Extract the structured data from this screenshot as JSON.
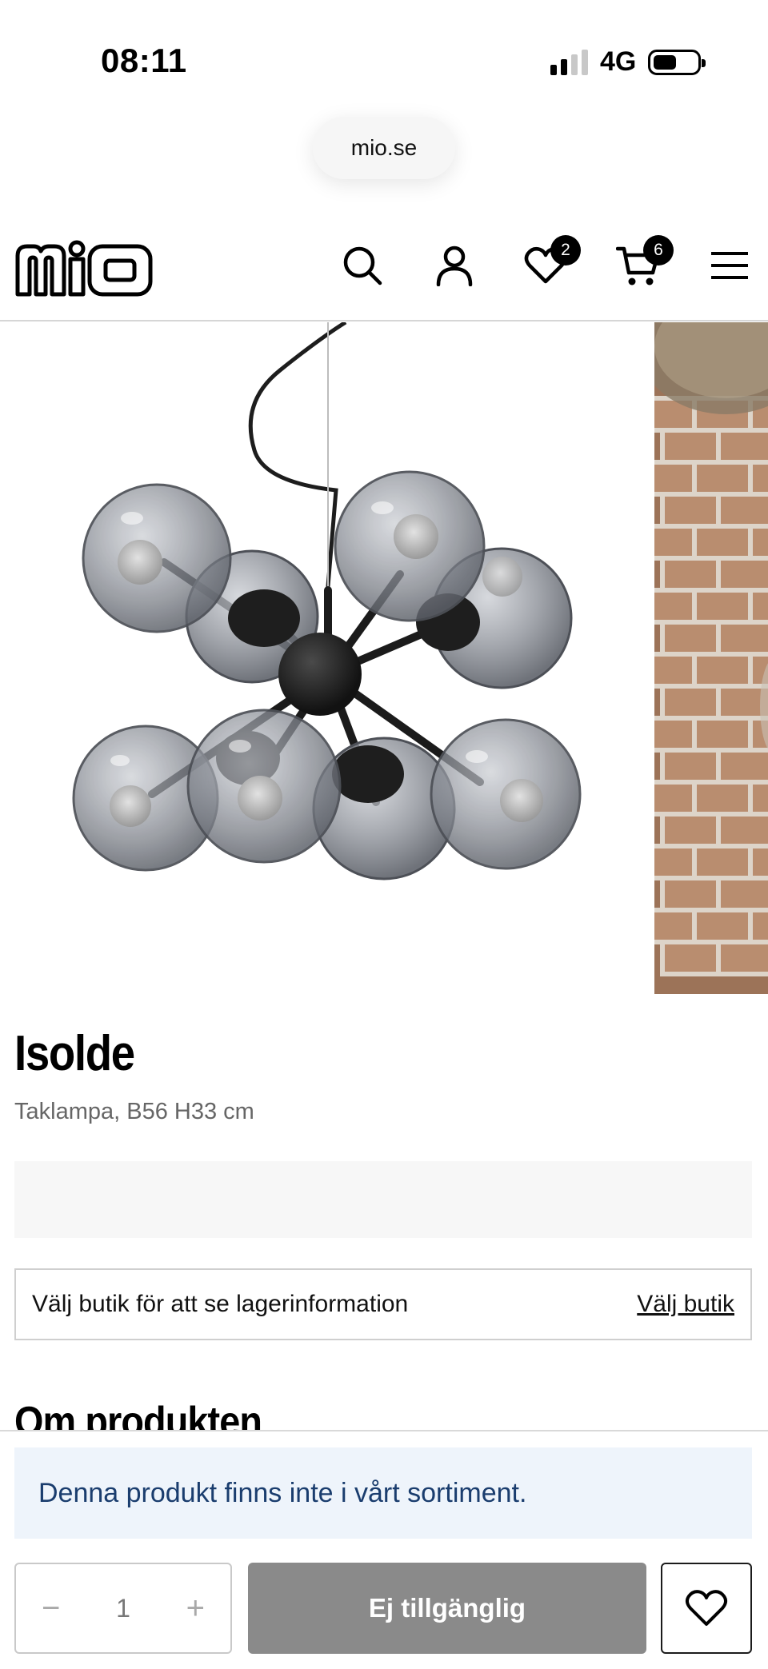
{
  "status_bar": {
    "time": "08:11",
    "network": "4G",
    "signal_bars": 2,
    "signal_bars_total": 4
  },
  "browser": {
    "url": "mio.se"
  },
  "header": {
    "logo_text": "mio",
    "icons": [
      "search-icon",
      "account-icon",
      "heart-icon",
      "cart-icon",
      "menu-icon"
    ],
    "wishlist_count": "2",
    "cart_count": "6"
  },
  "gallery": {
    "main_image": "chandelier-product-image",
    "side_image": "room-photo-brick-wall"
  },
  "product": {
    "title": "Isolde",
    "subtitle": "Taklampa, B56 H33 cm"
  },
  "store": {
    "text": "Välj butik för att se lagerinformation",
    "link_label": "Välj butik"
  },
  "section": {
    "heading": "Om produkten"
  },
  "sticky": {
    "notice": "Denna produkt finns inte i vårt sortiment.",
    "quantity": "1",
    "minus_label": "−",
    "plus_label": "+",
    "button_label": "Ej tillgänglig"
  },
  "colors": {
    "notice_bg": "#eef4fb",
    "notice_text": "#1a3d6e",
    "button_disabled": "#8a8a8a"
  }
}
